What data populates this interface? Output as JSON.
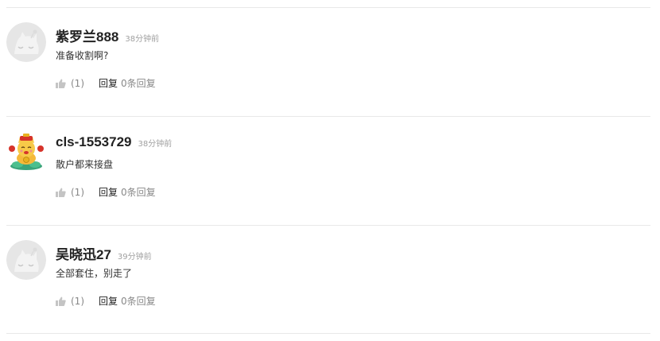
{
  "comments": [
    {
      "avatar_icon": "default-cat-avatar-icon",
      "username": "紫罗兰888",
      "time": "38分钟前",
      "content": "准备收割啊?",
      "like_count": "(1)",
      "reply_label": "回复",
      "reply_count": "0条回复"
    },
    {
      "avatar_icon": "fortune-cat-avatar-icon",
      "username": "cls-1553729",
      "time": "38分钟前",
      "content": "散户都来接盘",
      "like_count": "(1)",
      "reply_label": "回复",
      "reply_count": "0条回复"
    },
    {
      "avatar_icon": "default-cat-avatar-icon",
      "username": "吴晓迅27",
      "time": "39分钟前",
      "content": "全部套住，别走了",
      "like_count": "(1)",
      "reply_label": "回复",
      "reply_count": "0条回复"
    }
  ],
  "colors": {
    "divider": "#e9e9e9",
    "muted": "#888888",
    "time": "#a0a0a0",
    "username": "#222222"
  }
}
